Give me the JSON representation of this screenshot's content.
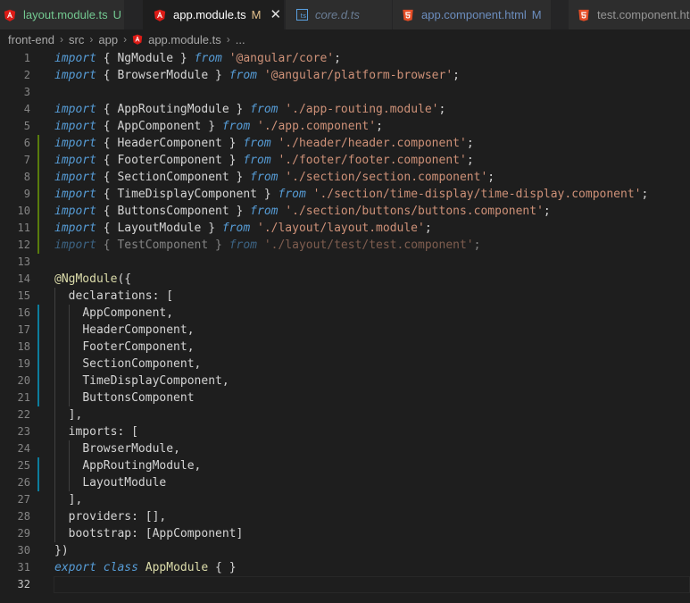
{
  "tabs": [
    {
      "label": "layout.module.ts",
      "badge": "U",
      "status": "untracked",
      "icon": "angular-icon",
      "active": false
    },
    {
      "label": "app.module.ts",
      "badge": "M",
      "status": "modified",
      "icon": "angular-icon",
      "active": true
    },
    {
      "label": "core.d.ts",
      "badge": "",
      "status": "preview",
      "icon": "typescript-icon",
      "active": false
    },
    {
      "label": "app.component.html",
      "badge": "M",
      "status": "modified",
      "icon": "html-icon",
      "active": false
    },
    {
      "label": "test.component.ht",
      "badge": "",
      "status": "normal",
      "icon": "html-icon",
      "active": false
    }
  ],
  "tab_close_glyph": "✕",
  "breadcrumb": [
    "front-end",
    "src",
    "app",
    "app.module.ts",
    "..."
  ],
  "breadcrumb_sep": "›",
  "colors": {
    "angular": "#dd1b16",
    "html": "#e44d26",
    "keyword": "#569cd6",
    "string": "#ce9178",
    "decorator": "#dcdcaa",
    "gutter_added": "#587c0c",
    "gutter_modified": "#0c7d9d"
  },
  "code_lines": [
    {
      "n": "1",
      "text": "import { NgModule } from '@angular/core';",
      "gutter": "none"
    },
    {
      "n": "2",
      "text": "import { BrowserModule } from '@angular/platform-browser';",
      "gutter": "none"
    },
    {
      "n": "3",
      "text": "",
      "gutter": "none"
    },
    {
      "n": "4",
      "text": "import { AppRoutingModule } from './app-routing.module';",
      "gutter": "none"
    },
    {
      "n": "5",
      "text": "import { AppComponent } from './app.component';",
      "gutter": "none"
    },
    {
      "n": "6",
      "text": "import { HeaderComponent } from './header/header.component';",
      "gutter": "added"
    },
    {
      "n": "7",
      "text": "import { FooterComponent } from './footer/footer.component';",
      "gutter": "added"
    },
    {
      "n": "8",
      "text": "import { SectionComponent } from './section/section.component';",
      "gutter": "added"
    },
    {
      "n": "9",
      "text": "import { TimeDisplayComponent } from './section/time-display/time-display.component';",
      "gutter": "added"
    },
    {
      "n": "10",
      "text": "import { ButtonsComponent } from './section/buttons/buttons.component';",
      "gutter": "added"
    },
    {
      "n": "11",
      "text": "import { LayoutModule } from './layout/layout.module';",
      "gutter": "added"
    },
    {
      "n": "12",
      "text": "import { TestComponent } from './layout/test/test.component';",
      "gutter": "added"
    },
    {
      "n": "13",
      "text": "",
      "gutter": "none"
    },
    {
      "n": "14",
      "text": "@NgModule({",
      "gutter": "none"
    },
    {
      "n": "15",
      "text": "  declarations: [",
      "gutter": "none"
    },
    {
      "n": "16",
      "text": "    AppComponent,",
      "gutter": "modified"
    },
    {
      "n": "17",
      "text": "    HeaderComponent,",
      "gutter": "modified"
    },
    {
      "n": "18",
      "text": "    FooterComponent,",
      "gutter": "modified"
    },
    {
      "n": "19",
      "text": "    SectionComponent,",
      "gutter": "modified"
    },
    {
      "n": "20",
      "text": "    TimeDisplayComponent,",
      "gutter": "modified"
    },
    {
      "n": "21",
      "text": "    ButtonsComponent",
      "gutter": "modified"
    },
    {
      "n": "22",
      "text": "  ],",
      "gutter": "none"
    },
    {
      "n": "23",
      "text": "  imports: [",
      "gutter": "none"
    },
    {
      "n": "24",
      "text": "    BrowserModule,",
      "gutter": "none"
    },
    {
      "n": "25",
      "text": "    AppRoutingModule,",
      "gutter": "modified"
    },
    {
      "n": "26",
      "text": "    LayoutModule",
      "gutter": "modified"
    },
    {
      "n": "27",
      "text": "  ],",
      "gutter": "none"
    },
    {
      "n": "28",
      "text": "  providers: [],",
      "gutter": "none"
    },
    {
      "n": "29",
      "text": "  bootstrap: [AppComponent]",
      "gutter": "none"
    },
    {
      "n": "30",
      "text": "})",
      "gutter": "none"
    },
    {
      "n": "31",
      "text": "export class AppModule { }",
      "gutter": "none"
    },
    {
      "n": "32",
      "text": "",
      "gutter": "none"
    }
  ]
}
